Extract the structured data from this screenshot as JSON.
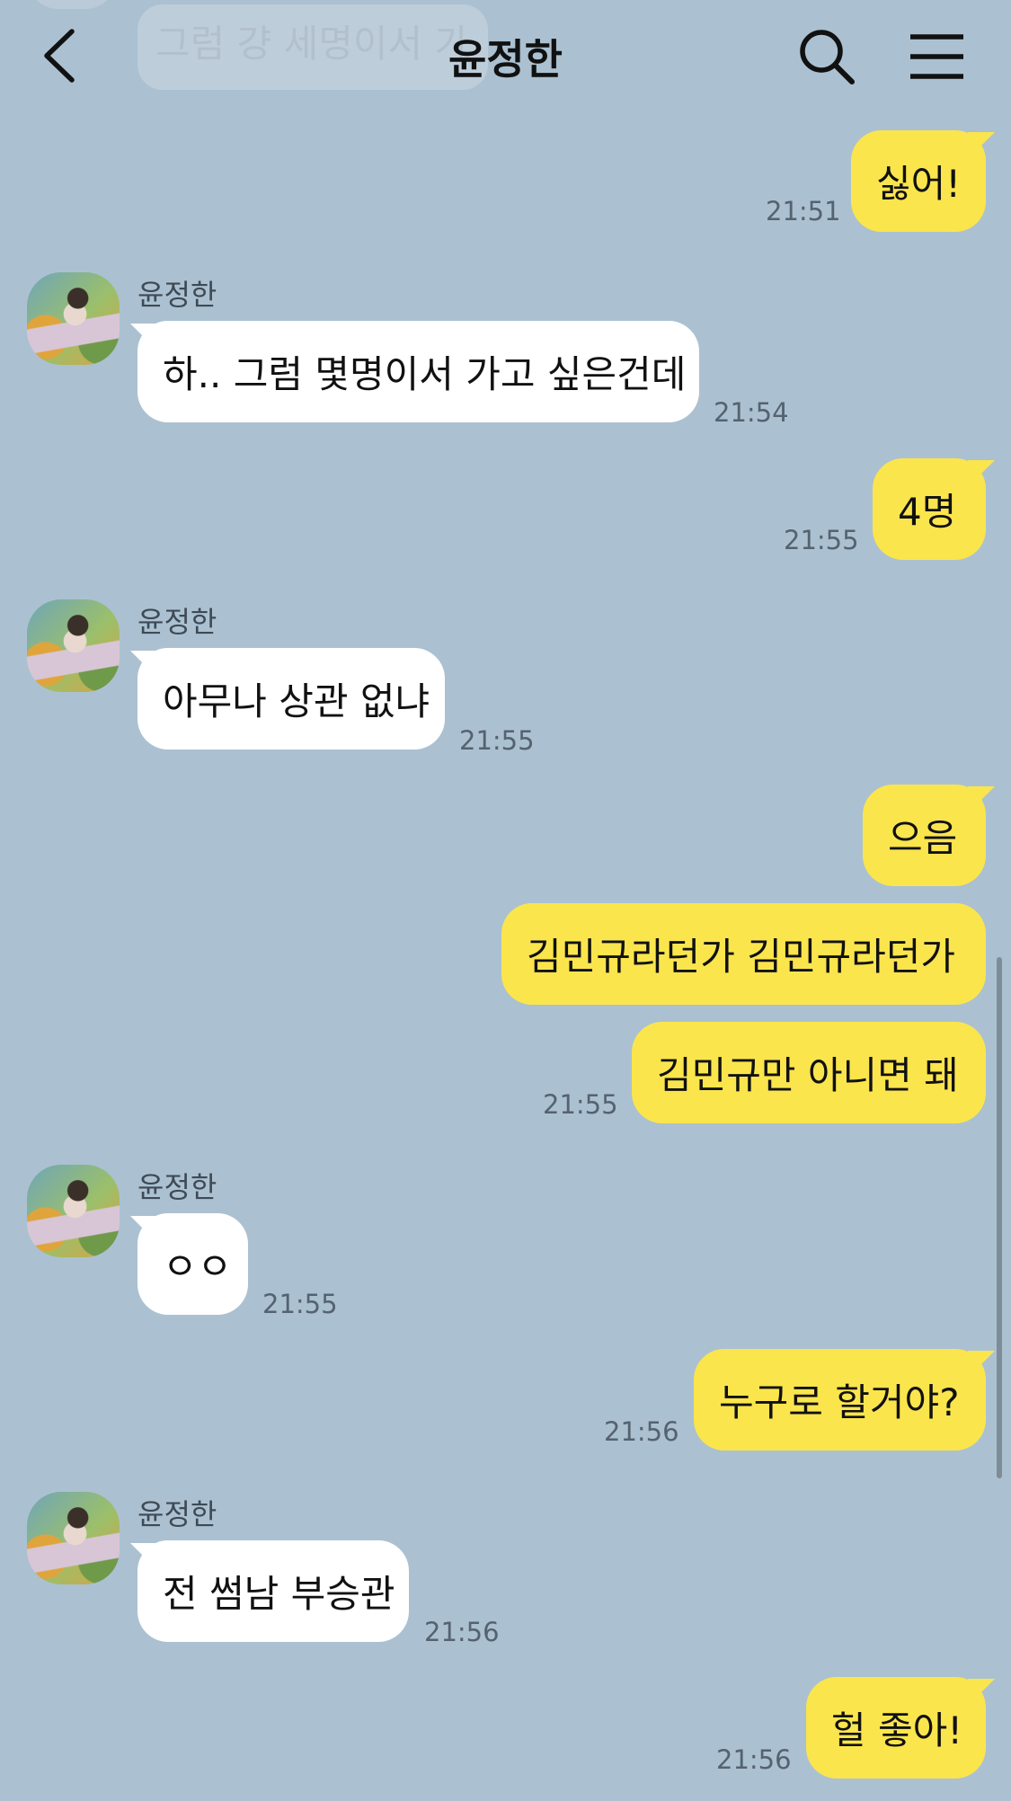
{
  "header": {
    "title": "윤정한",
    "icons": {
      "back": "chevron-left-icon",
      "search": "search-icon",
      "menu": "menu-icon"
    }
  },
  "colors": {
    "background": "#abc1d1",
    "my_bubble": "#fbe54d",
    "their_bubble": "#ffffff"
  },
  "faded_message": "그럼 걍 세명이서 가",
  "messages": [
    {
      "from": "me",
      "text": "싫어!",
      "time": "21:51"
    },
    {
      "from": "them",
      "sender": "윤정한",
      "text": "하.. 그럼 몇명이서 가고 싶은건데",
      "time": "21:54"
    },
    {
      "from": "me",
      "text": "4명",
      "time": "21:55"
    },
    {
      "from": "them",
      "sender": "윤정한",
      "text": "아무나 상관 없냐",
      "time": "21:55"
    },
    {
      "from": "me",
      "text": "으음",
      "time": ""
    },
    {
      "from": "me",
      "text": "김민규라던가 김민규라던가",
      "time": ""
    },
    {
      "from": "me",
      "text": "김민규만 아니면 돼",
      "time": "21:55"
    },
    {
      "from": "them",
      "sender": "윤정한",
      "text": "ㅇㅇ",
      "time": "21:55"
    },
    {
      "from": "me",
      "text": "누구로 할거야?",
      "time": "21:56"
    },
    {
      "from": "them",
      "sender": "윤정한",
      "text": "전 썸남 부승관",
      "time": "21:56"
    },
    {
      "from": "me",
      "text": "헐 좋아!",
      "time": "21:56"
    }
  ]
}
